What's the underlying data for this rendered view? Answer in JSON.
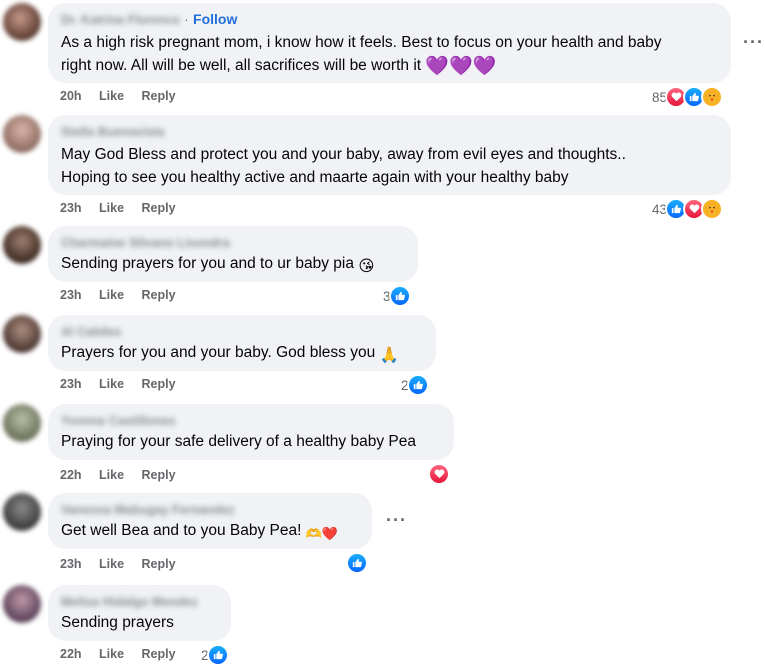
{
  "comments": [
    {
      "author": "Dr. Katrina Florence",
      "follow": "Follow",
      "text_line1": "As a high risk pregnant mom, i know how it feels. Best to focus on your health and baby",
      "text_line2": "right now. All will be well, all sacrifices will be worth it",
      "emoji": "💜💜💜",
      "time": "20h",
      "like": "Like",
      "reply": "Reply",
      "reaction_count": "85",
      "reactions": [
        "love-icon",
        "like-icon",
        "care-icon"
      ]
    },
    {
      "author": "Stella Buenavista",
      "text_line1": "May God Bless and protect you and your baby, away from evil eyes and thoughts..",
      "text_line2": "Hoping to see you healthy active and maarte again with your healthy baby",
      "time": "23h",
      "like": "Like",
      "reply": "Reply",
      "reaction_count": "43",
      "reactions": [
        "like-icon",
        "love-icon",
        "care-icon"
      ]
    },
    {
      "author": "Charmaine Silvano Lisondra",
      "text": "Sending prayers for you and to ur baby pia",
      "emoji": "😘",
      "time": "23h",
      "like": "Like",
      "reply": "Reply",
      "reaction_count": "3",
      "reactions": [
        "like-icon"
      ]
    },
    {
      "author": "Al Cabiles",
      "text": "Prayers for you and your baby. God bless you",
      "emoji": "🙏",
      "time": "23h",
      "like": "Like",
      "reply": "Reply",
      "reaction_count": "2",
      "reactions": [
        "like-icon"
      ]
    },
    {
      "author": "Yvonne Castillones",
      "text": "Praying for your safe delivery of a healthy baby Pea",
      "time": "22h",
      "like": "Like",
      "reply": "Reply",
      "reaction_count": "",
      "reactions": [
        "love-icon"
      ]
    },
    {
      "author": "Vanessa Mabugay Fernandez",
      "text": "Get well Bea and to you Baby Pea!",
      "emoji": "🫶❤️",
      "time": "23h",
      "like": "Like",
      "reply": "Reply",
      "reaction_count": "",
      "reactions": [
        "like-icon"
      ]
    },
    {
      "author": "Melisa Hidalgo Mendez",
      "text": "Sending prayers",
      "time": "22h",
      "like": "Like",
      "reply": "Reply",
      "reaction_count": "2",
      "reactions": [
        "like-icon"
      ]
    }
  ],
  "colors": {
    "bubble": "#f0f2f5",
    "meta_text": "#65676b",
    "follow": "#216fdb",
    "like_icon": "#0866ff",
    "love_icon": "#e61739",
    "care_icon": "#f7b125"
  },
  "icons": {
    "more": "more-options-icon",
    "more_glyph": "···"
  }
}
